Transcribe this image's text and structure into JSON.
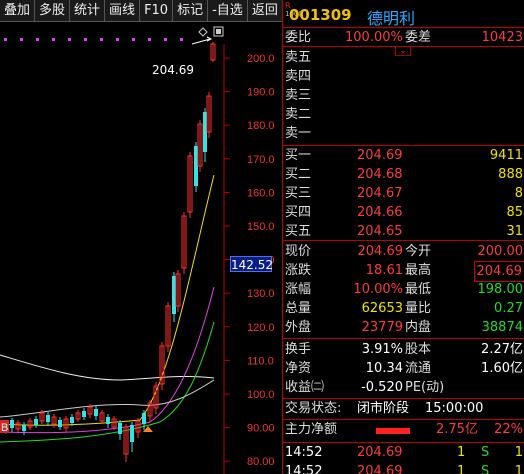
{
  "toolbar": {
    "items": [
      "叠加",
      "多股",
      "统计",
      "画线",
      "F10",
      "标记",
      "-自选",
      "返回"
    ]
  },
  "chart": {
    "price_axis": [
      "200.0",
      "190.0",
      "180.0",
      "170.0",
      "160.0",
      "150.0",
      "140.0",
      "130.0",
      "120.0",
      "110.0",
      "100.0",
      "90.00",
      "80.00"
    ],
    "current_price_tag": "142.52",
    "high_label": "204.69",
    "marker": "B"
  },
  "stock": {
    "prefix": "R",
    "sub": "1000",
    "code": "001309",
    "name": "德明利"
  },
  "order_ratio": {
    "label1": "委比",
    "value1": "100.00%",
    "label2": "委差",
    "value2": "10423"
  },
  "asks": [
    {
      "label": "卖五",
      "price": "",
      "vol": ""
    },
    {
      "label": "卖四",
      "price": "",
      "vol": ""
    },
    {
      "label": "卖三",
      "price": "",
      "vol": ""
    },
    {
      "label": "卖二",
      "price": "",
      "vol": ""
    },
    {
      "label": "卖一",
      "price": "",
      "vol": ""
    }
  ],
  "bids": [
    {
      "label": "买一",
      "price": "204.69",
      "vol": "9411"
    },
    {
      "label": "买二",
      "price": "204.68",
      "vol": "888"
    },
    {
      "label": "买三",
      "price": "204.67",
      "vol": "8"
    },
    {
      "label": "买四",
      "price": "204.66",
      "vol": "85"
    },
    {
      "label": "买五",
      "price": "204.65",
      "vol": "31"
    }
  ],
  "quote": [
    {
      "l1": "现价",
      "v1": "204.69",
      "l2": "今开",
      "v2": "200.00"
    },
    {
      "l1": "涨跌",
      "v1": "18.61",
      "l2": "最高",
      "v2": "204.69"
    },
    {
      "l1": "涨幅",
      "v1": "10.00%",
      "l2": "最低",
      "v2": "198.00"
    },
    {
      "l1": "总量",
      "v1": "62653",
      "l2": "量比",
      "v2": "0.27"
    },
    {
      "l1": "外盘",
      "v1": "23779",
      "l2": "内盘",
      "v2": "38874"
    }
  ],
  "fin": [
    {
      "l1": "换手",
      "v1": "3.91%",
      "l2": "股本",
      "v2": "2.27亿"
    },
    {
      "l1": "净资",
      "v1": "10.34",
      "l2": "流通",
      "v2": "1.60亿"
    },
    {
      "l1": "收益㈡",
      "v1": "-0.520",
      "l2": "PE(动)",
      "v2": ""
    }
  ],
  "status": {
    "label": "交易状态:",
    "value": "闭市阶段",
    "time": "15:00:00"
  },
  "main_flow": {
    "label": "主力净额",
    "value": "2.75亿",
    "pct": "22%"
  },
  "ticks": [
    {
      "time": "14:52",
      "price": "204.69",
      "vol": "1",
      "side": "S",
      "n": "1"
    },
    {
      "time": "14:52",
      "price": "204.69",
      "vol": "1",
      "side": "S",
      "n": "1"
    }
  ],
  "colors": {
    "up": "#ff3a3a",
    "down": "#22dd22",
    "accent": "#f0c000"
  }
}
